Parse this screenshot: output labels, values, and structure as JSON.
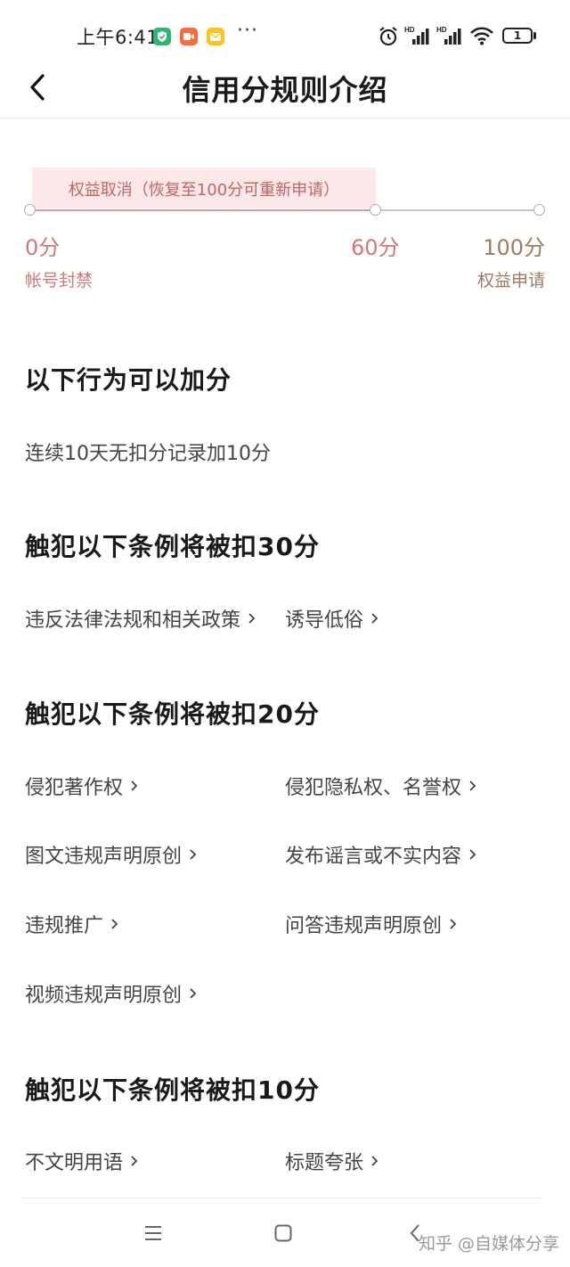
{
  "status_bar": {
    "time": "上午6:41",
    "more": "···",
    "battery": "1",
    "hd_label": "HD"
  },
  "nav": {
    "title": "信用分规则介绍"
  },
  "scale": {
    "banner": "权益取消（恢复至100分可重新申请）",
    "points": [
      {
        "value": "0分",
        "label": "帐号封禁"
      },
      {
        "value": "60分",
        "label": ""
      },
      {
        "value": "100分",
        "label": "权益申请"
      }
    ]
  },
  "sections": {
    "add": {
      "title": "以下行为可以加分",
      "text": "连续10天无扣分记录加10分"
    },
    "minus30": {
      "title": "触犯以下条例将被扣30分",
      "links": [
        "违反法律法规和相关政策",
        "诱导低俗"
      ]
    },
    "minus20": {
      "title": "触犯以下条例将被扣20分",
      "links": [
        "侵犯著作权",
        "侵犯隐私权、名誉权",
        "图文违规声明原创",
        "发布谣言或不实内容",
        "违规推广",
        "问答违规声明原创",
        "视频违规声明原创"
      ]
    },
    "minus10": {
      "title": "触犯以下条例将被扣10分",
      "links": [
        "不文明用语",
        "标题夸张"
      ]
    }
  },
  "watermark": "知乎 @自媒体分享",
  "colors": {
    "banner_bg": "#fce8e8",
    "red_text": "#c06464",
    "red_value": "#d27878",
    "brown_label": "#a07a60"
  }
}
